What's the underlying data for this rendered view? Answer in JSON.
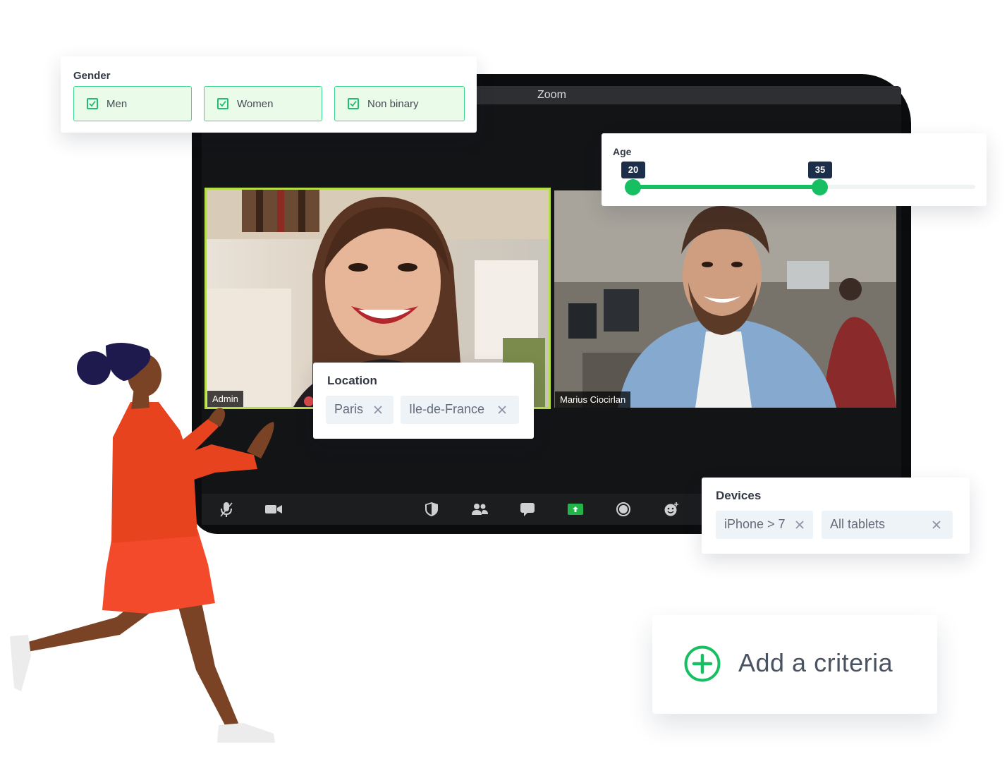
{
  "zoom_window": {
    "title": "Zoom",
    "participants": [
      {
        "name": "Admin"
      },
      {
        "name": "Marius Ciocirlan"
      }
    ],
    "toolbar_icons": [
      "microphone-icon",
      "camera-icon",
      "shield-icon",
      "participants-icon",
      "chat-icon",
      "share-screen-icon",
      "record-icon",
      "reactions-icon"
    ],
    "active_speaker_color": "#b7dc4a",
    "share_color": "#23b34a"
  },
  "gender_filter": {
    "title": "Gender",
    "options": [
      {
        "label": "Men",
        "checked": true
      },
      {
        "label": "Women",
        "checked": true
      },
      {
        "label": "Non binary",
        "checked": true
      }
    ]
  },
  "age_filter": {
    "title": "Age",
    "min_value": "20",
    "max_value": "35"
  },
  "location_filter": {
    "title": "Location",
    "tags": [
      "Paris",
      "Ile-de-France"
    ]
  },
  "devices_filter": {
    "title": "Devices",
    "tags": [
      "iPhone > 7",
      "All tablets"
    ]
  },
  "add_criteria": {
    "label": "Add a criteria"
  },
  "colors": {
    "accent_green": "#17bf62",
    "check_bg": "#ebfbea",
    "tag_bg": "#eef3f8",
    "age_badge": "#1c2e4a"
  }
}
